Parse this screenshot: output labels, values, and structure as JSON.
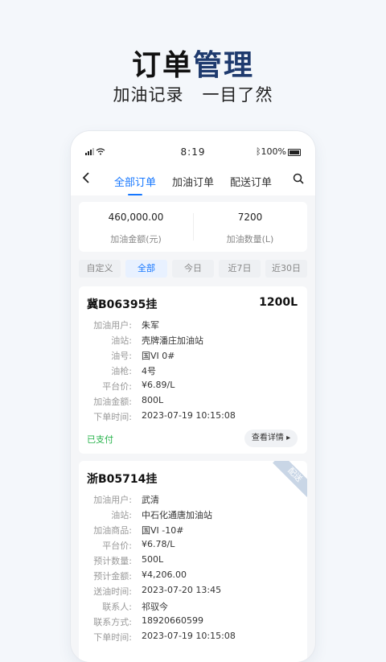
{
  "hero": {
    "title_part1": "订单",
    "title_part2": "管理",
    "subtitle": "加油记录   一目了然"
  },
  "status_bar": {
    "time": "8:19",
    "battery": "100%"
  },
  "nav": {
    "tabs": [
      {
        "label": "全部订单",
        "active": true
      },
      {
        "label": "加油订单",
        "active": false
      },
      {
        "label": "配送订单",
        "active": false
      }
    ]
  },
  "stats": [
    {
      "value": "460,000.00",
      "label": "加油金额(元)"
    },
    {
      "value": "7200",
      "label": "加油数量(L)"
    }
  ],
  "filters": [
    {
      "label": "自定义",
      "active": false
    },
    {
      "label": "全部",
      "active": true
    },
    {
      "label": "今日",
      "active": false
    },
    {
      "label": "近7日",
      "active": false
    },
    {
      "label": "近30日",
      "active": false
    }
  ],
  "orders": [
    {
      "plate": "冀B06395挂",
      "volume": "1200L",
      "fields": [
        {
          "label": "加油用户:",
          "value": "朱军"
        },
        {
          "label": "油站:",
          "value": "壳牌潘庄加油站"
        },
        {
          "label": "油号:",
          "value": "国VI 0#"
        },
        {
          "label": "油枪:",
          "value": "4号"
        },
        {
          "label": "平台价:",
          "value": "¥6.89/L"
        },
        {
          "label": "加油金额:",
          "value": "800L"
        },
        {
          "label": "下单时间:",
          "value": "2023-07-19 10:15:08"
        }
      ],
      "status": "已支付",
      "action": "查看详情"
    },
    {
      "plate": "浙B05714挂",
      "ribbon": "配送",
      "fields": [
        {
          "label": "加油用户:",
          "value": "武清"
        },
        {
          "label": "油站:",
          "value": "中石化通唐加油站"
        },
        {
          "label": "加油商品:",
          "value": "国VI -10#"
        },
        {
          "label": "平台价:",
          "value": "¥6.78/L"
        },
        {
          "label": "预计数量:",
          "value": "500L"
        },
        {
          "label": "预计金额:",
          "value": "¥4,206.00"
        },
        {
          "label": "送油时间:",
          "value": "2023-07-20 13:45"
        },
        {
          "label": "联系人:",
          "value": "祁驭今"
        },
        {
          "label": "联系方式:",
          "value": "18920660599"
        },
        {
          "label": "下单时间:",
          "value": "2023-07-19 10:15:08"
        }
      ]
    }
  ],
  "colors": {
    "accent": "#1677ff",
    "paid": "#27b34b",
    "hero_accent": "#1e3a6e"
  }
}
